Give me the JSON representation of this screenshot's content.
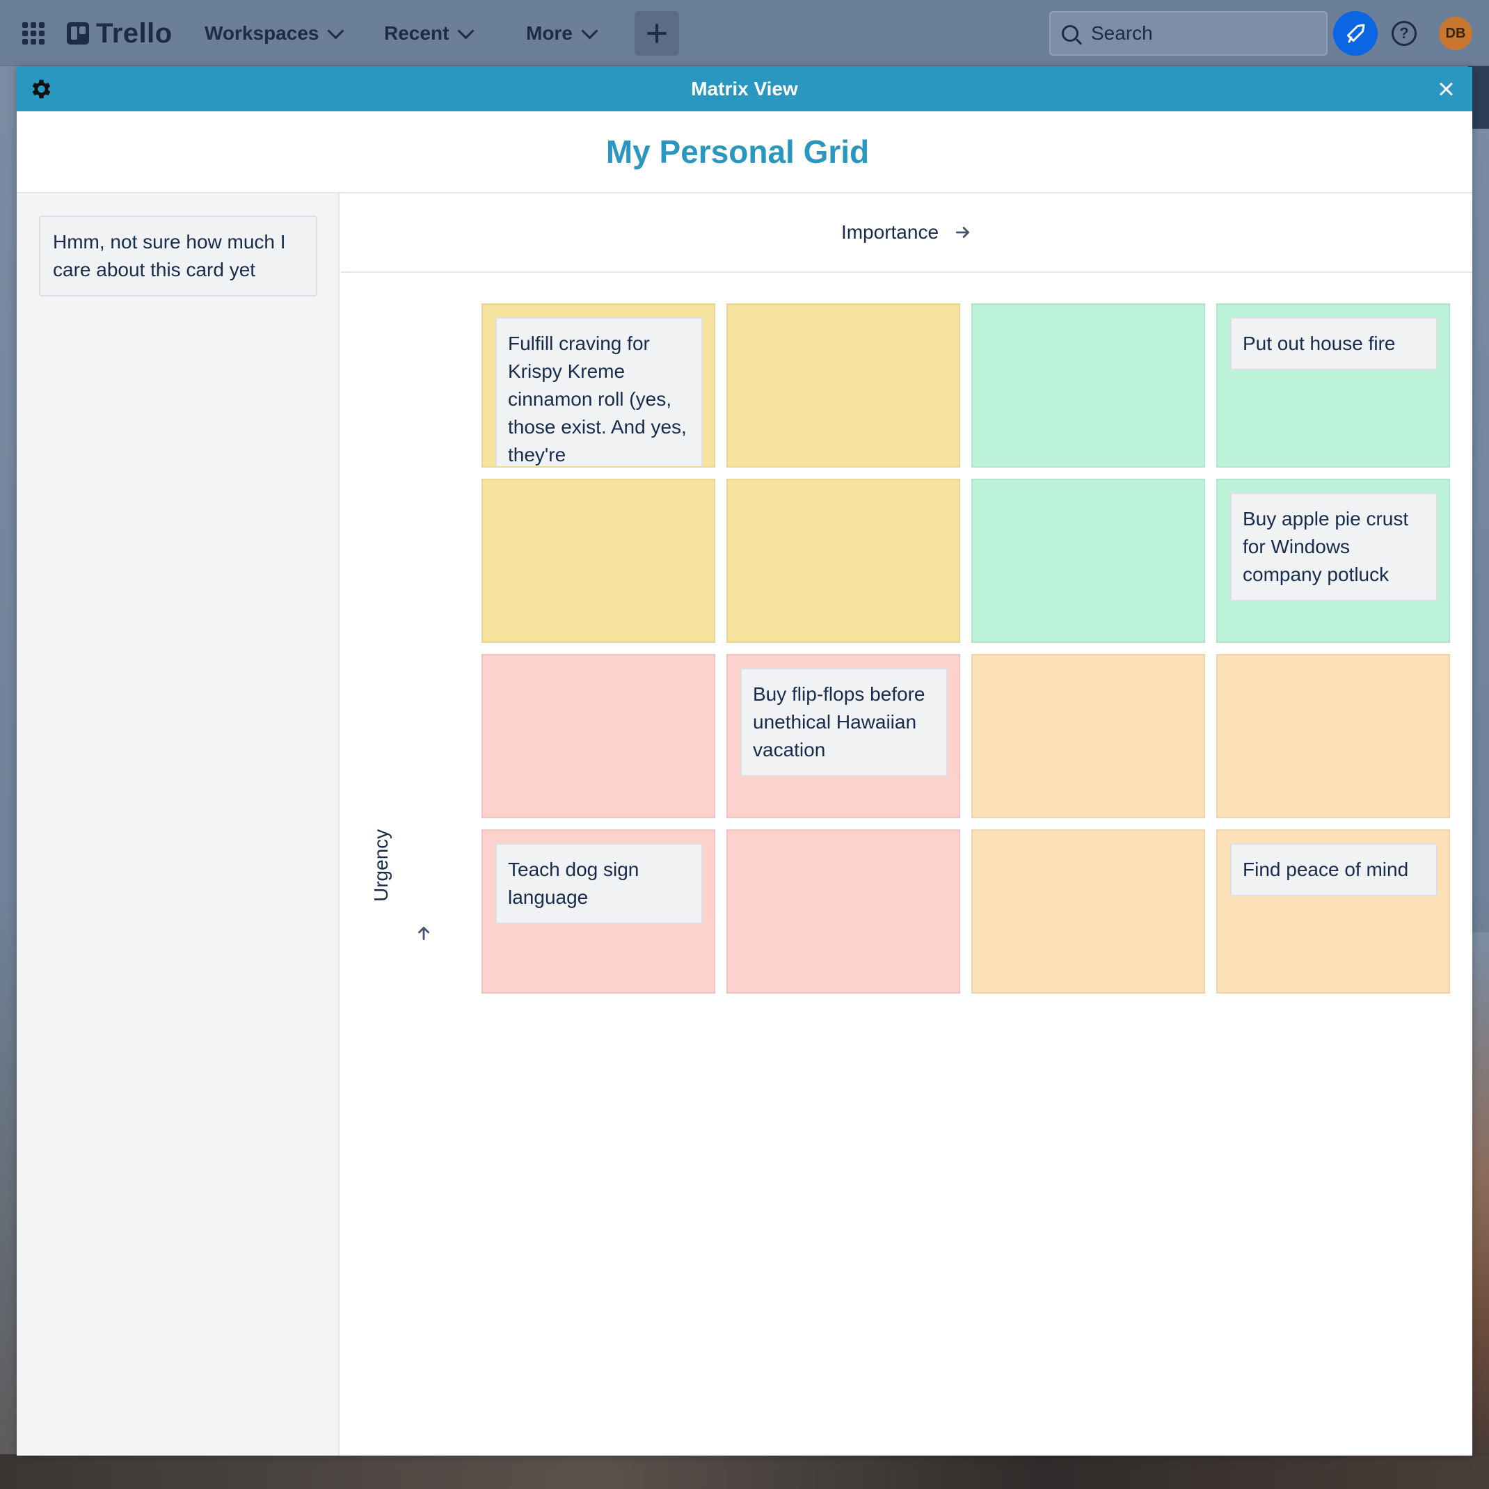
{
  "nav": {
    "logo": "Trello",
    "menus": [
      "Workspaces",
      "Recent",
      "More"
    ],
    "search_placeholder": "Search",
    "avatar_initials": "DB"
  },
  "modal": {
    "header_title": "Matrix View",
    "grid_title": "My Personal Grid",
    "x_axis_label": "Importance",
    "y_axis_label": "Urgency"
  },
  "backlog": {
    "cards": [
      "Hmm, not sure how much I care about this card yet"
    ]
  },
  "matrix": {
    "colors": {
      "yellow": "#f6e49e",
      "green": "#bdf2da",
      "red": "#fdd1cc",
      "orange": "#fde0b8",
      "header": "#2997c0",
      "title": "#2997c0"
    },
    "cells": [
      {
        "color": "yellow",
        "card": "Fulfill craving for Krispy Kreme cinnamon roll (yes, those exist. And yes, they're"
      },
      {
        "color": "yellow",
        "card": ""
      },
      {
        "color": "green",
        "card": ""
      },
      {
        "color": "green",
        "card": "Put out house fire"
      },
      {
        "color": "yellow",
        "card": ""
      },
      {
        "color": "yellow",
        "card": ""
      },
      {
        "color": "green",
        "card": ""
      },
      {
        "color": "green",
        "card": "Buy apple pie crust for Windows company potluck"
      },
      {
        "color": "red",
        "card": ""
      },
      {
        "color": "red",
        "card": "Buy flip-flops before unethical Hawaiian vacation"
      },
      {
        "color": "orange",
        "card": ""
      },
      {
        "color": "orange",
        "card": ""
      },
      {
        "color": "red",
        "card": "Teach dog sign language"
      },
      {
        "color": "red",
        "card": ""
      },
      {
        "color": "orange",
        "card": ""
      },
      {
        "color": "orange",
        "card": "Find peace of mind"
      }
    ]
  }
}
